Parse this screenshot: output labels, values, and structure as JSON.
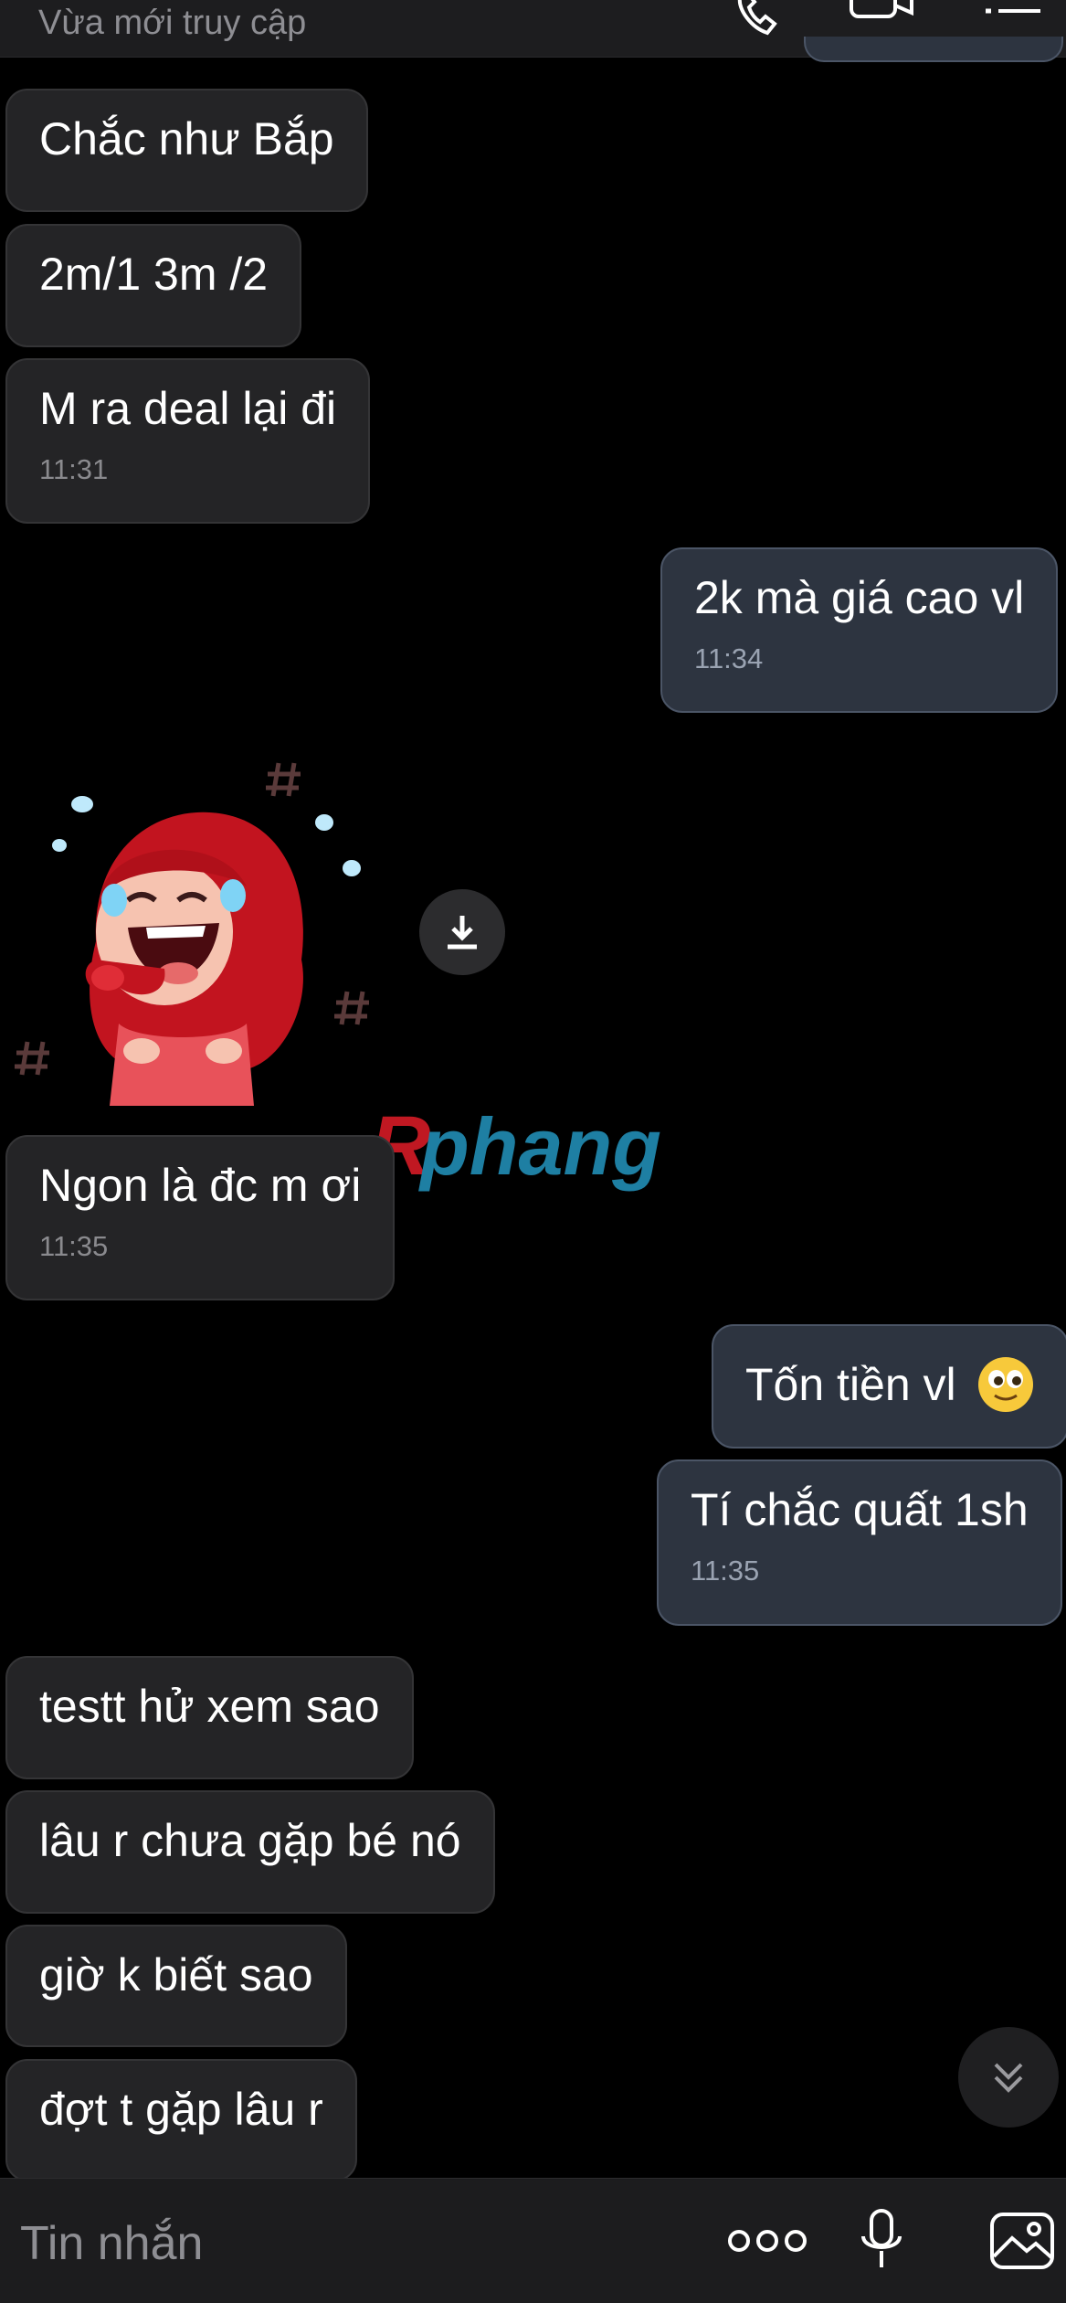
{
  "header": {
    "status": "Vừa mới truy cập",
    "icons": [
      "phone-icon",
      "video-call-icon",
      "menu-icon"
    ]
  },
  "messages": [
    {
      "side": "in",
      "text": "Chắc như Bắp"
    },
    {
      "side": "in",
      "text": "2m/1 3m /2"
    },
    {
      "side": "in",
      "text": "M ra deal lại đi",
      "time": "11:31"
    },
    {
      "side": "out",
      "text": "2k mà giá cao vl",
      "time": "11:34"
    },
    {
      "side": "in",
      "type": "sticker",
      "description_icon": "crying-laughing-girl-sticker"
    },
    {
      "side": "in",
      "text": "Ngon là đc m ơi",
      "time": "11:35"
    },
    {
      "side": "out",
      "text": "Tốn tiền vl",
      "emoji": "smiling-face-icon"
    },
    {
      "side": "out",
      "text": "Tí chắc quất 1sh",
      "time": "11:35"
    },
    {
      "side": "in",
      "text": "testt hử xem sao"
    },
    {
      "side": "in",
      "text": "lâu r chưa gặp bé nó"
    },
    {
      "side": "in",
      "text": "giờ k biết sao"
    },
    {
      "side": "in",
      "text": "đợt t gặp lâu r"
    }
  ],
  "watermark": "Rphang",
  "composer": {
    "placeholder": "Tin nhắn",
    "icons": [
      "more-icon",
      "microphone-icon",
      "image-icon"
    ]
  },
  "colors": {
    "background": "#000000",
    "incoming_bubble": "#242426",
    "outgoing_bubble": "#2d3440",
    "outgoing_border": "#4b5566",
    "timestamp": "#8a8a8e"
  }
}
